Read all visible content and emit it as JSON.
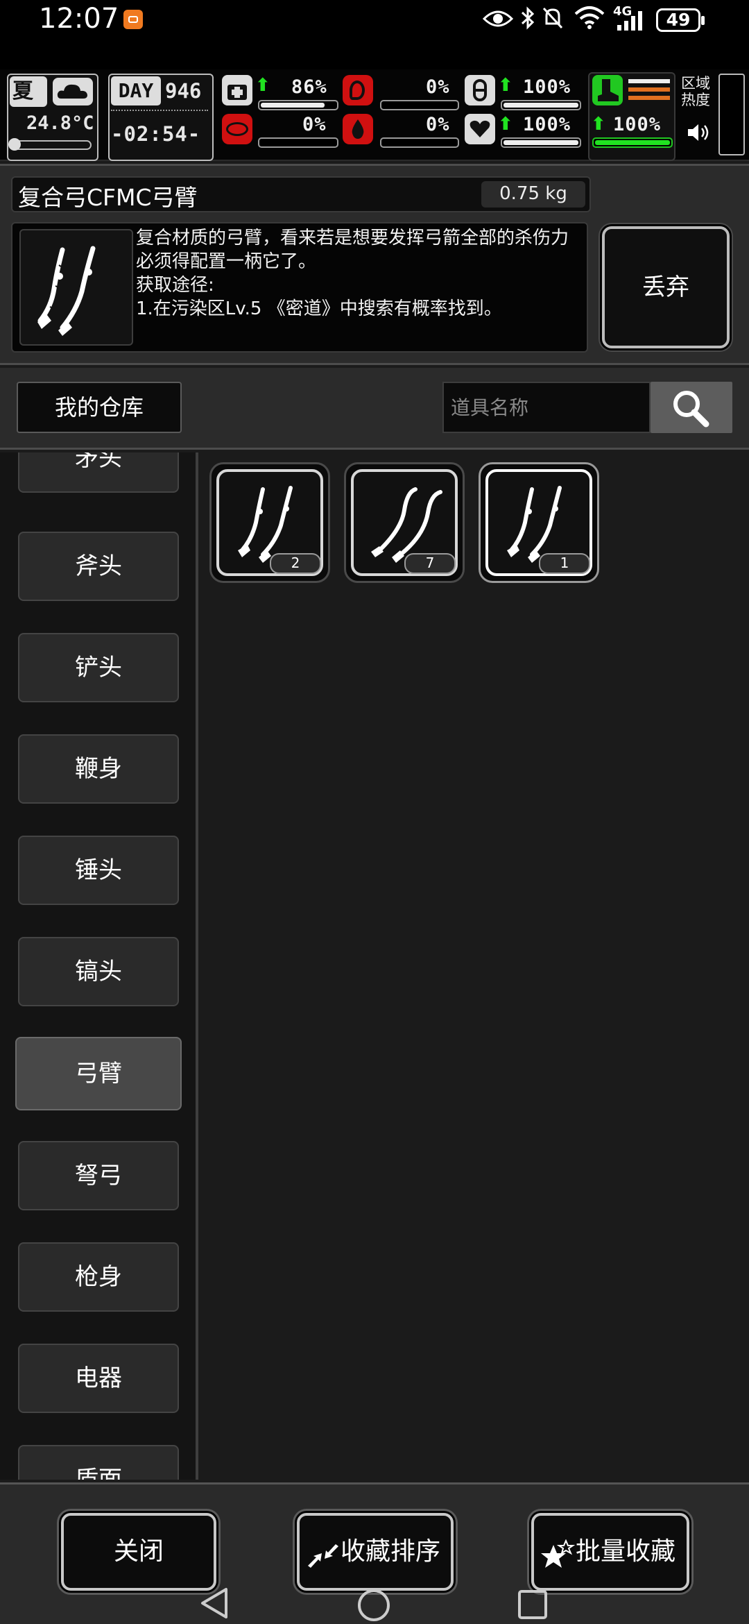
{
  "status_bar": {
    "time": "12:07",
    "battery": "49",
    "network": "4G"
  },
  "hud": {
    "season": "夏",
    "temperature": "24.8°C",
    "day_label": "DAY",
    "day": "946",
    "clock": "-02:54-",
    "stats": [
      {
        "name": "health",
        "icon": "medkit-icon",
        "value": "86%",
        "level": 0.86,
        "trend": "up"
      },
      {
        "name": "hunger",
        "icon": "stomach-icon",
        "value": "0%",
        "level": 0.0,
        "trend": ""
      },
      {
        "name": "thirst",
        "icon": "capsule-icon",
        "value": "100%",
        "level": 1.0,
        "trend": "up"
      },
      {
        "name": "sanity",
        "icon": "brain-icon",
        "value": "0%",
        "level": 0.0,
        "trend": ""
      },
      {
        "name": "blood",
        "icon": "blood-drop-icon",
        "value": "0%",
        "level": 0.0,
        "trend": ""
      },
      {
        "name": "mood",
        "icon": "heart-hand-icon",
        "value": "100%",
        "level": 1.0,
        "trend": "up"
      }
    ],
    "stamina": {
      "value": "100%",
      "level": 1.0
    },
    "zone_heat_label": "区域热度"
  },
  "item": {
    "name": "复合弓CFMC弓臂",
    "weight": "0.75 kg",
    "description": "复合材质的弓臂，看来若是想要发挥弓箭全部的杀伤力必须得配置一柄它了。\n获取途径:\n1.在污染区Lv.5 《密道》中搜索有概率找到。",
    "discard_label": "丢弃"
  },
  "search": {
    "warehouse_label": "我的仓库",
    "placeholder": "道具名称"
  },
  "categories": [
    "矛头",
    "斧头",
    "铲头",
    "鞭身",
    "锤头",
    "镐头",
    "弓臂",
    "弩弓",
    "枪身",
    "电器",
    "盾面"
  ],
  "active_category": "弓臂",
  "inventory": [
    {
      "icon": "bow-limb-icon",
      "count": "2"
    },
    {
      "icon": "bow-limb-curved-icon",
      "count": "7"
    },
    {
      "icon": "bow-limb-icon",
      "count": "1"
    }
  ],
  "buttons": {
    "close": "关闭",
    "sort": "收藏排序",
    "batch_favorite": "批量收藏"
  },
  "colors": {
    "accent_green": "#21e321",
    "stamina_orange": "#e07020",
    "blood_red": "#d01010"
  }
}
